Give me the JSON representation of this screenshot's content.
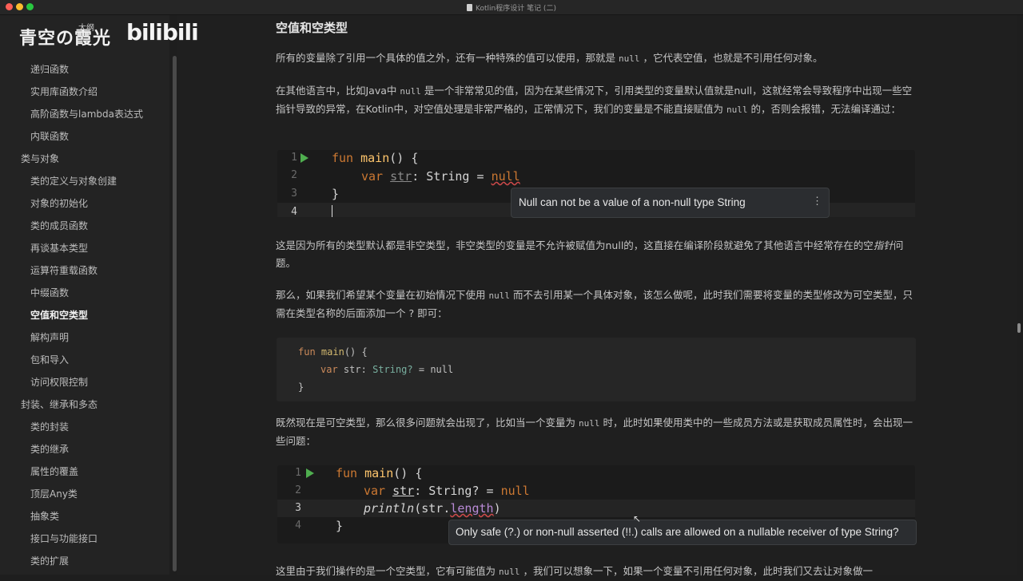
{
  "window": {
    "title": "Kotlin程序设计 笔记 (二)"
  },
  "watermark": {
    "name": "青空の霞光",
    "sub": "大纲",
    "brand": "bilibili"
  },
  "sidebar": {
    "items": [
      {
        "label": "递归函数",
        "level": 2
      },
      {
        "label": "实用库函数介绍",
        "level": 2
      },
      {
        "label": "高阶函数与lambda表达式",
        "level": 2
      },
      {
        "label": "内联函数",
        "level": 2
      },
      {
        "label": "类与对象",
        "level": 1
      },
      {
        "label": "类的定义与对象创建",
        "level": 2
      },
      {
        "label": "对象的初始化",
        "level": 2
      },
      {
        "label": "类的成员函数",
        "level": 2
      },
      {
        "label": "再谈基本类型",
        "level": 2
      },
      {
        "label": "运算符重载函数",
        "level": 2
      },
      {
        "label": "中缀函数",
        "level": 2
      },
      {
        "label": "空值和空类型",
        "level": 2,
        "active": true
      },
      {
        "label": "解构声明",
        "level": 2
      },
      {
        "label": "包和导入",
        "level": 2
      },
      {
        "label": "访问权限控制",
        "level": 2
      },
      {
        "label": "封装、继承和多态",
        "level": 1
      },
      {
        "label": "类的封装",
        "level": 2
      },
      {
        "label": "类的继承",
        "level": 2
      },
      {
        "label": "属性的覆盖",
        "level": 2
      },
      {
        "label": "顶层Any类",
        "level": 2
      },
      {
        "label": "抽象类",
        "level": 2
      },
      {
        "label": "接口与功能接口",
        "level": 2
      },
      {
        "label": "类的扩展",
        "level": 2
      }
    ]
  },
  "content": {
    "heading": "空值和空类型",
    "p1a": "所有的变量除了引用一个具体的值之外，还有一种特殊的值可以使用，那就是 ",
    "p1code": "null",
    "p1b": " ，它代表空值，也就是不引用任何对象。",
    "p2a": "在其他语言中，比如Java中 ",
    "p2code1": "null",
    "p2b": " 是一个非常常见的值，因为在某些情况下，引用类型的变量默认值就是null，这就经常会导致程序中出现一些空指针导致的异常，在Kotlin中，对空值处理是非常严格的，正常情况下，我们的变量是不能直接赋值为 ",
    "p2code2": "null",
    "p2c": " 的，否则会报错，无法编译通过：",
    "ide1": {
      "lines": [
        "1",
        "2",
        "3",
        "4"
      ],
      "l1_kw": "fun",
      "l1_fn": "main",
      "l1_rest": "() {",
      "l2_kw": "var",
      "l2_name": "str",
      "l2_rest": ": String = ",
      "l2_null": "null",
      "l3": "}",
      "tooltip": "Null can not be a value of a non-null type String"
    },
    "p3a": "这是因为所有的类型默认都是非空类型，非空类型的变量是不允许被赋值为null的，这直接在编译阶段就避免了其他语言中经常存在的空",
    "p3em": "指针",
    "p3b": "问题。",
    "p4a": "那么，如果我们希望某个变量在初始情况下使用 ",
    "p4code": "null",
    "p4b": " 而不去引用某一个具体对象，该怎么做呢，此时我们需要将变量的类型修改为可空类型，只需在类型名称的后面添加一个 ? 即可：",
    "codeblock": {
      "l1_kw": "fun",
      "l1_fn": "main",
      "l1_rest": "() {",
      "l2_kw": "var",
      "l2_name": "str",
      "l2_colon": ": ",
      "l2_type": "String?",
      "l2_rest": " = null",
      "l3": "}"
    },
    "p5a": "既然现在是可空类型，那么很多问题就会出现了，比如当一个变量为 ",
    "p5code": "null",
    "p5b": " 时，此时如果使用类中的一些成员方法或是获取成员属性时，会出现一些问题：",
    "ide2": {
      "lines": [
        "1",
        "2",
        "3",
        "4"
      ],
      "l1_kw": "fun",
      "l1_fn": "main",
      "l1_rest": "() {",
      "l2_kw": "var",
      "l2_name": "str",
      "l2_rest": ": String? = ",
      "l2_null": "null",
      "l3_fn": "println",
      "l3_rest": "(str.",
      "l3_prop": "length",
      "l3_end": ")",
      "l4": "}",
      "tooltip": "Only safe (?.) or non-null asserted (!!.) calls are allowed on a nullable receiver of type String?"
    },
    "p6a": "这里由于我们操作的是一个空类型，它有可能值为 ",
    "p6code": "null",
    "p6b": " ，我们可以想象一下，如果一个变量不引用任何对象，此时我们又去让对象做一"
  }
}
